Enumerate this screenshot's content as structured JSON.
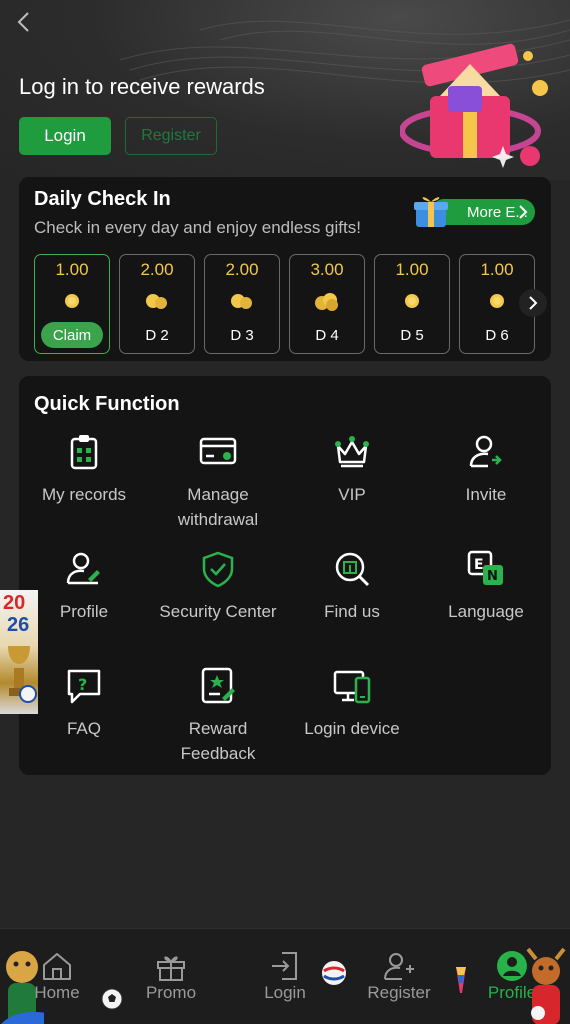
{
  "header": {
    "login_prompt": "Log in to receive rewards",
    "login_label": "Login",
    "register_label": "Register"
  },
  "checkin": {
    "title": "Daily Check In",
    "subtitle": "Check in every day and enjoy endless gifts!",
    "more_label": "More E...",
    "days": [
      {
        "amount": "1.00",
        "label": "Claim",
        "claim": true
      },
      {
        "amount": "2.00",
        "label": "D 2"
      },
      {
        "amount": "2.00",
        "label": "D 3"
      },
      {
        "amount": "3.00",
        "label": "D 4"
      },
      {
        "amount": "1.00",
        "label": "D 5"
      },
      {
        "amount": "1.00",
        "label": "D 6"
      }
    ]
  },
  "quick": {
    "title": "Quick Function",
    "items": [
      {
        "label": "My records",
        "icon": "records-icon"
      },
      {
        "label": "Manage withdrawal",
        "icon": "wallet-card-icon"
      },
      {
        "label": "VIP",
        "icon": "crown-icon"
      },
      {
        "label": "Invite",
        "icon": "invite-user-icon"
      },
      {
        "label": "Profile",
        "icon": "profile-edit-icon"
      },
      {
        "label": "Security Center",
        "icon": "shield-check-icon"
      },
      {
        "label": "Find us",
        "icon": "search-building-icon"
      },
      {
        "label": "Language",
        "icon": "language-icon"
      },
      {
        "label": "FAQ",
        "icon": "faq-icon"
      },
      {
        "label": "Reward Feedback",
        "icon": "feedback-icon"
      },
      {
        "label": "Login device",
        "icon": "device-icon"
      }
    ]
  },
  "side_banner": {
    "line1": "20",
    "line2": "26"
  },
  "tabs": [
    {
      "label": "Home",
      "icon": "home-icon"
    },
    {
      "label": "Promo",
      "icon": "gift-icon"
    },
    {
      "label": "Login",
      "icon": "login-icon"
    },
    {
      "label": "Register",
      "icon": "register-icon"
    },
    {
      "label": "Profile",
      "icon": "profile-icon",
      "active": true
    }
  ],
  "colors": {
    "accent": "#1f9c3e",
    "coin": "#f2c84b",
    "card_bg": "#141414",
    "page_bg": "#262626"
  }
}
